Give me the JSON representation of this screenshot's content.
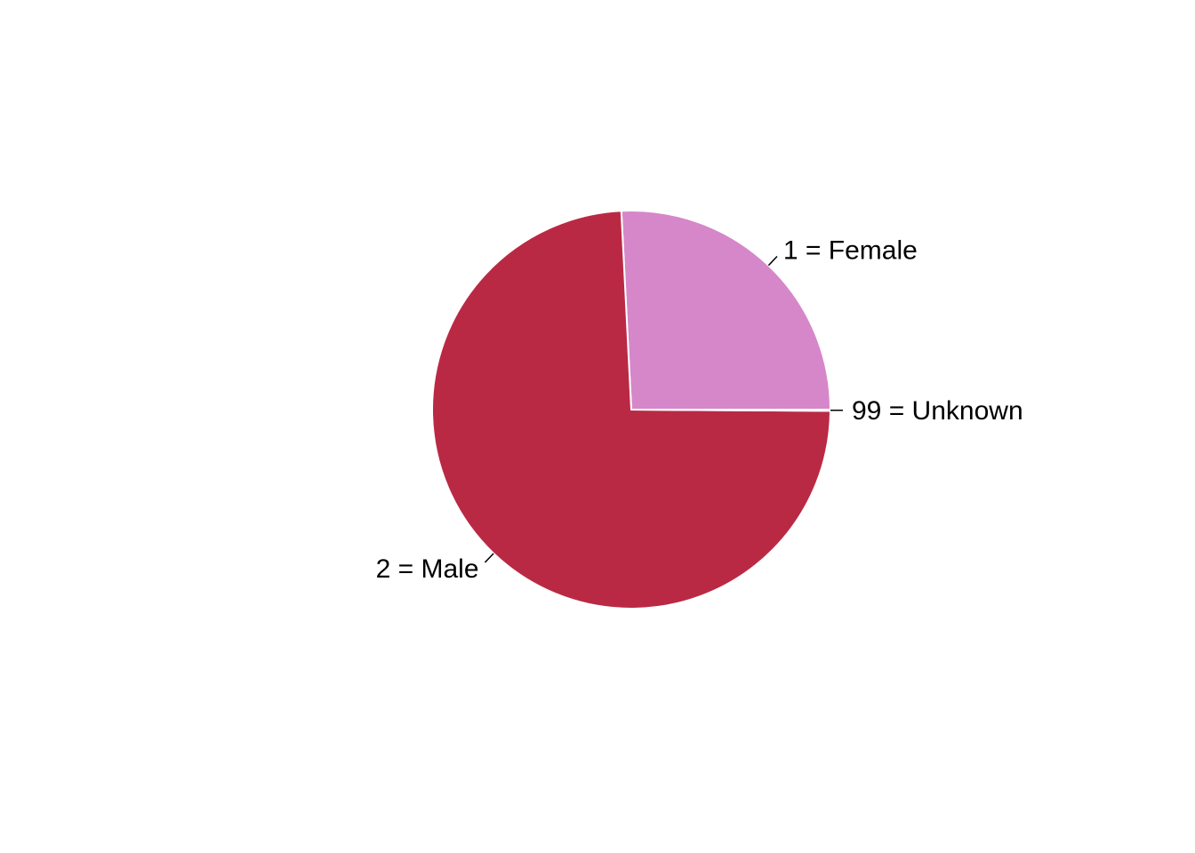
{
  "chart_data": {
    "type": "pie",
    "title": "",
    "start": "counterclockwise from 3 o'clock",
    "slices": [
      {
        "label": "1 = Female",
        "value": 25.8,
        "color": "#D687C9"
      },
      {
        "label": "2 = Male",
        "value": 74.1,
        "color": "#BA2944"
      },
      {
        "label": "99 = Unknown",
        "value": 0.1,
        "color": "#BA2944"
      }
    ],
    "slice_border_color": "#FFFFFF"
  }
}
